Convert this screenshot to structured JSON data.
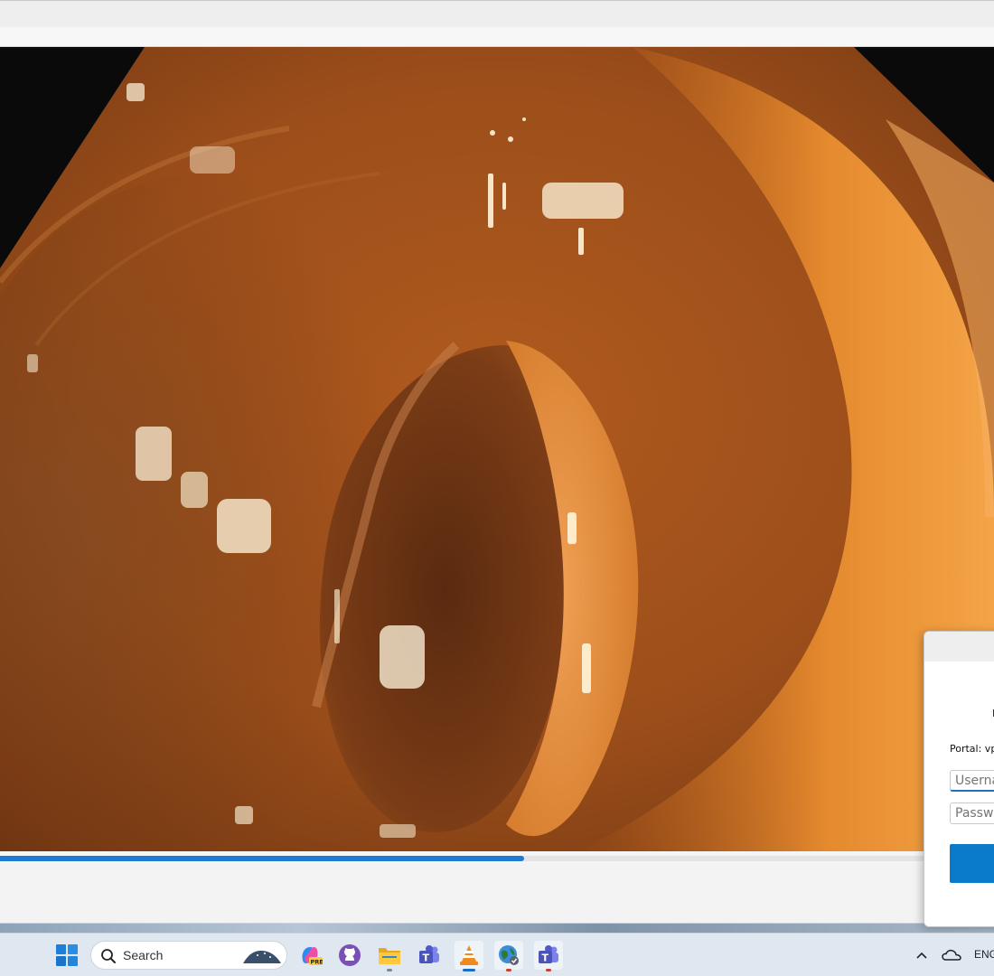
{
  "player": {
    "progress": 0.527
  },
  "login_dialog": {
    "portal_label": "Portal: vp",
    "username_placeholder": "Userna",
    "password_placeholder": "Passwo",
    "connect_label": ""
  },
  "taskbar": {
    "search_label": "Search",
    "language": "ENG",
    "icons": [
      "windows-start-icon",
      "search-icon",
      "copilot-icon",
      "github-icon",
      "file-explorer-icon",
      "teams-icon",
      "vlc-icon",
      "vpn-globe-icon",
      "teams-work-icon",
      "chevron-up-icon",
      "onedrive-cloud-icon"
    ]
  },
  "colors": {
    "accent": "#1f7ad6",
    "dialog_button": "#0a7bc8",
    "taskbar": "#dfe7f0"
  }
}
